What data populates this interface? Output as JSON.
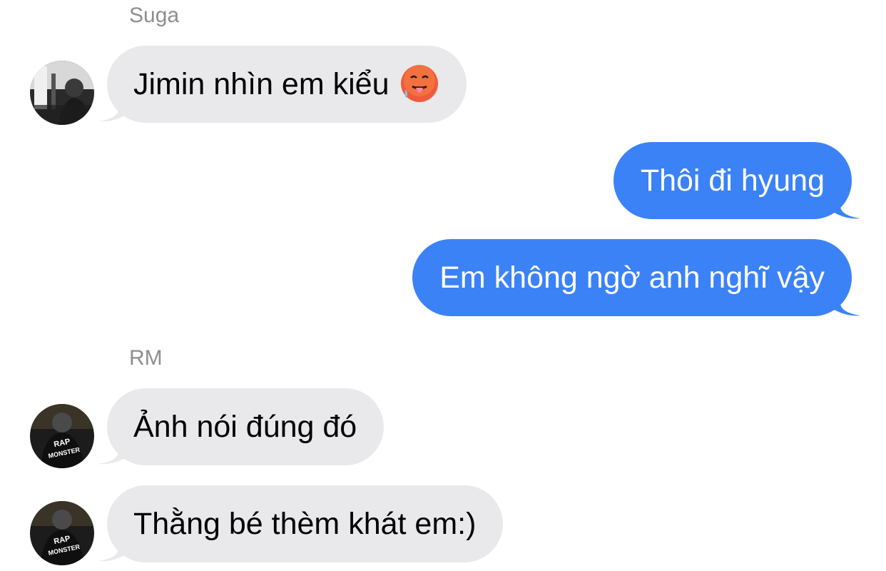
{
  "conversation": {
    "groups": [
      {
        "sender": "Suga",
        "messages": [
          {
            "text": "Jimin nhìn em kiểu",
            "emoji": "hot-face-emoji"
          }
        ]
      },
      {
        "sender": "me",
        "messages": [
          {
            "text": "Thôi đi hyung"
          },
          {
            "text": "Em không ngờ anh nghĩ vậy"
          }
        ]
      },
      {
        "sender": "RM",
        "messages": [
          {
            "text": "Ảnh nói đúng đó"
          },
          {
            "text": "Thằng bé thèm khát em:)"
          }
        ]
      }
    ]
  },
  "colors": {
    "incoming_bubble": "#e9e9eb",
    "outgoing_bubble": "#3b82f6",
    "sender_name": "#8e8e93"
  },
  "avatars": {
    "suga": "person-photo-icon",
    "rm": "rap-monster-photo-icon"
  },
  "avatar_text": {
    "rm_line1": "RAP",
    "rm_line2": "MONSTER"
  }
}
